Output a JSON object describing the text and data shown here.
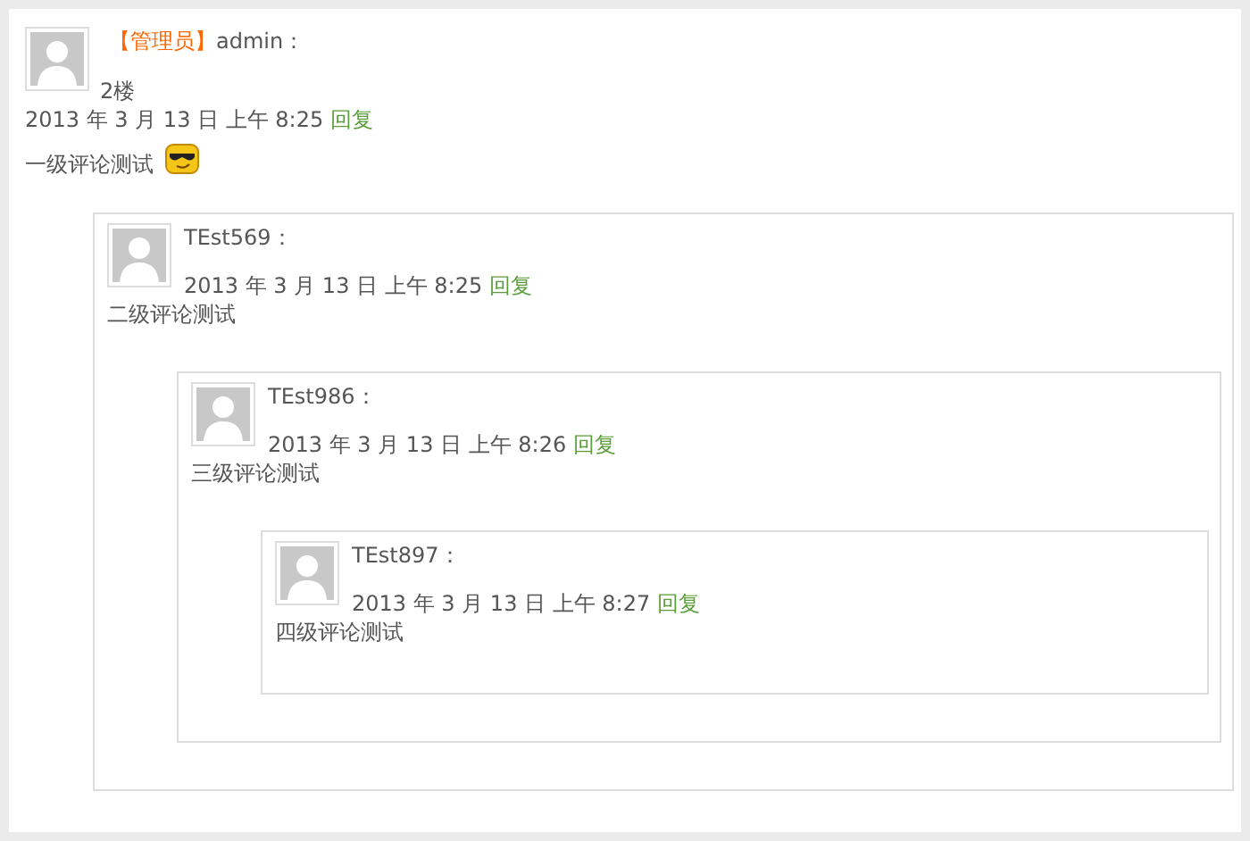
{
  "comment": {
    "role": "【管理员】",
    "author": "admin：",
    "floor": "2楼",
    "date": "2013 年 3 月 13 日 上午 8:25",
    "reply_label": "回复",
    "text": "一级评论测试",
    "emoji": true,
    "children": [
      {
        "author": "TEst569：",
        "date": "2013 年 3 月 13 日 上午 8:25",
        "reply_label": "回复",
        "text": "二级评论测试",
        "children": [
          {
            "author": "TEst986：",
            "date": "2013 年 3 月 13 日 上午 8:26",
            "reply_label": "回复",
            "text": "三级评论测试",
            "children": [
              {
                "author": "TEst897：",
                "date": "2013 年 3 月 13 日 上午 8:27",
                "reply_label": "回复",
                "text": "四级评论测试"
              }
            ]
          }
        ]
      }
    ]
  }
}
